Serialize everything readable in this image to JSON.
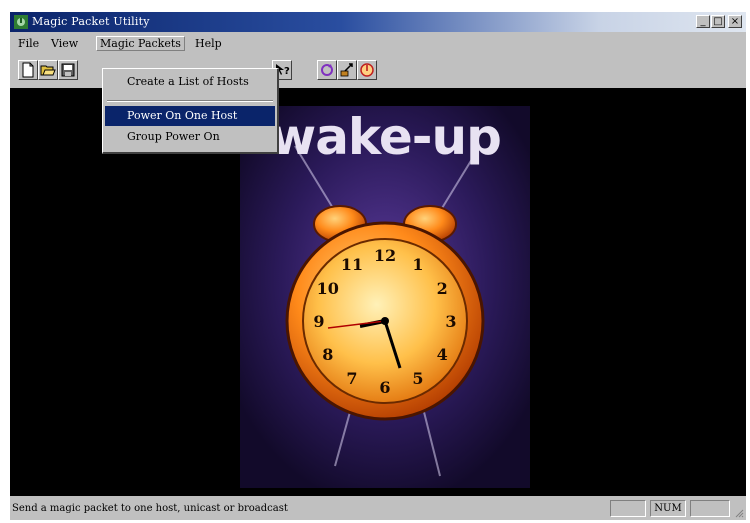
{
  "window": {
    "title": "Magic Packet Utility",
    "minimize_glyph": "_",
    "maximize_glyph": "□",
    "close_glyph": "×"
  },
  "menubar": {
    "items": [
      {
        "label": "File"
      },
      {
        "label": "View"
      },
      {
        "label": "Magic Packets"
      },
      {
        "label": "Help"
      }
    ]
  },
  "toolbar": {
    "buttons": [
      {
        "icon": "new-document-icon"
      },
      {
        "icon": "open-folder-icon"
      },
      {
        "icon": "save-icon"
      },
      {
        "icon": "context-help-icon"
      },
      {
        "icon": "refresh-icon"
      },
      {
        "icon": "send-packet-icon"
      },
      {
        "icon": "power-icon"
      }
    ]
  },
  "dropdown": {
    "items": [
      {
        "label": "Create a List of Hosts"
      },
      {
        "label": "Power On One Host"
      },
      {
        "label": "Group Power On"
      }
    ]
  },
  "poster": {
    "text": "wake-up",
    "clock_numbers": [
      "12",
      "1",
      "2",
      "3",
      "4",
      "5",
      "6",
      "7",
      "8",
      "9",
      "10",
      "11"
    ]
  },
  "statusbar": {
    "message": "Send a magic packet to one host, unicast or broadcast",
    "panel_num": "NUM"
  },
  "colors": {
    "titlebar": "#0a246a",
    "selection": "#0a246a",
    "face": "#c0c0c0",
    "client_bg": "#000000"
  }
}
